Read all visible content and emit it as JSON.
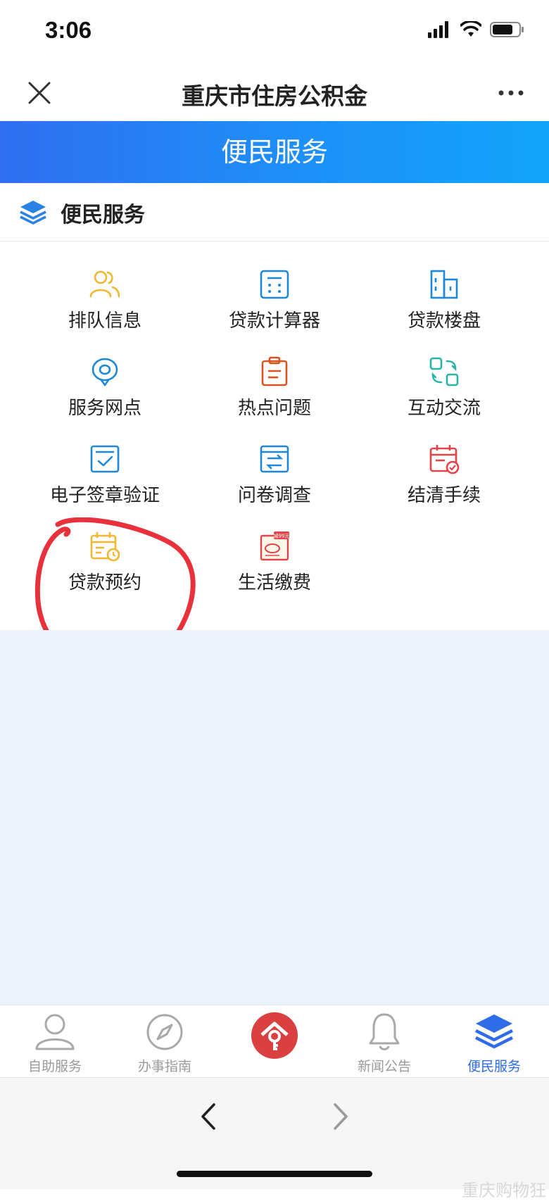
{
  "status_bar": {
    "time": "3:06"
  },
  "nav": {
    "title": "重庆市住房公积金"
  },
  "banner": {
    "title": "便民服务"
  },
  "section": {
    "title": "便民服务"
  },
  "grid": {
    "items": [
      {
        "label": "排队信息",
        "icon": "people-icon",
        "color": "#f2b630"
      },
      {
        "label": "贷款计算器",
        "icon": "calculator-icon",
        "color": "#1e88d8"
      },
      {
        "label": "贷款楼盘",
        "icon": "building-icon",
        "color": "#1e88d8"
      },
      {
        "label": "服务网点",
        "icon": "location-icon",
        "color": "#1e88d8"
      },
      {
        "label": "热点问题",
        "icon": "clipboard-icon",
        "color": "#d9531e"
      },
      {
        "label": "互动交流",
        "icon": "exchange-icon",
        "color": "#27b3a5"
      },
      {
        "label": "电子签章验证",
        "icon": "verify-icon",
        "color": "#1e88d8"
      },
      {
        "label": "问卷调查",
        "icon": "survey-icon",
        "color": "#1e88d8"
      },
      {
        "label": "结清手续",
        "icon": "calendar-settle-icon",
        "color": "#e0454a"
      },
      {
        "label": "贷款预约",
        "icon": "calendar-clock-icon",
        "color": "#f2b630"
      },
      {
        "label": "生活缴费",
        "icon": "bill-icon",
        "color": "#e0454a"
      }
    ]
  },
  "bill_badge": "减99元",
  "tab_bar": {
    "tabs": [
      {
        "label": "自助服务",
        "icon": "user-icon",
        "active": false
      },
      {
        "label": "办事指南",
        "icon": "compass-icon",
        "active": false
      },
      {
        "label": "",
        "icon": "home-key-icon",
        "active": false
      },
      {
        "label": "新闻公告",
        "icon": "bell-icon",
        "active": false
      },
      {
        "label": "便民服务",
        "icon": "layers-icon",
        "active": true
      }
    ]
  },
  "watermark": "重庆购物狂",
  "colors": {
    "banner_start": "#2f6ff0",
    "banner_end": "#12a4fb",
    "accent": "#2e6ce8",
    "annotation": "#e8313a"
  }
}
